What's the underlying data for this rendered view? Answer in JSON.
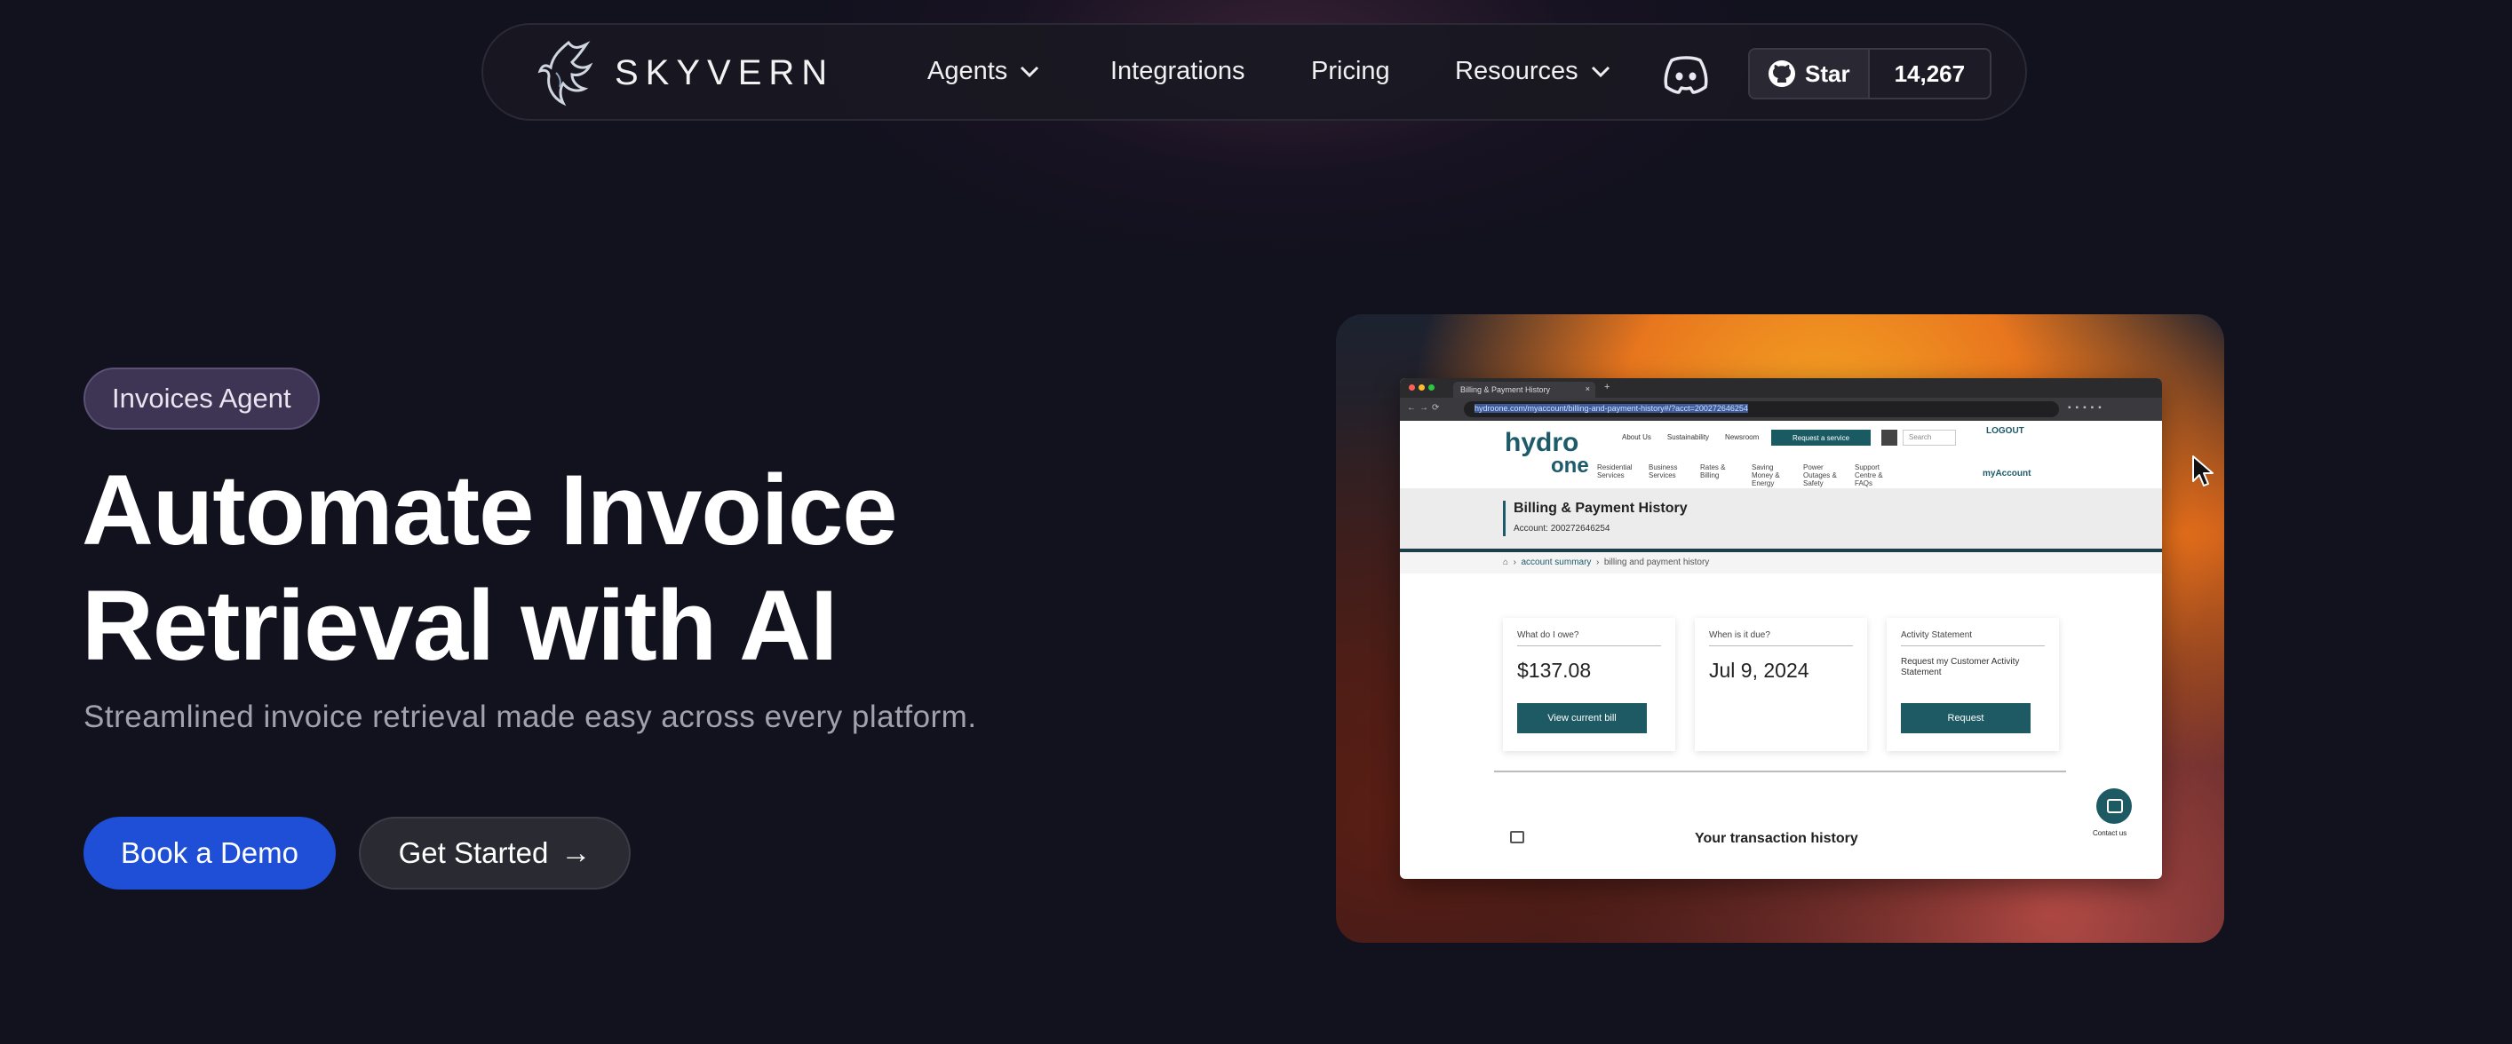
{
  "nav": {
    "brand": "SKYVERN",
    "items": [
      {
        "label": "Agents",
        "has_dropdown": true
      },
      {
        "label": "Integrations",
        "has_dropdown": false
      },
      {
        "label": "Pricing",
        "has_dropdown": false
      },
      {
        "label": "Resources",
        "has_dropdown": true
      }
    ],
    "discord_icon": "discord-icon",
    "github": {
      "star_label": "Star",
      "count": "14,267"
    }
  },
  "hero": {
    "badge": "Invoices Agent",
    "title_line1": "Automate Invoice",
    "title_line2": "Retrieval with AI",
    "subtitle": "Streamlined invoice retrieval made easy across every platform.",
    "primary_cta": "Book a Demo",
    "secondary_cta": "Get Started",
    "secondary_cta_arrow": "→"
  },
  "demo": {
    "tab_title": "Billing & Payment History",
    "url": "hydroone.com/myaccount/billing-and-payment-history#/?acct=200272646254",
    "site": {
      "brand_top": "hydro",
      "brand_bottom": "one",
      "top_links": [
        "About Us",
        "Sustainability",
        "Newsroom"
      ],
      "request_service": "Request a service",
      "search_placeholder": "Search",
      "logout": "LOGOUT",
      "my_account": "myAccount",
      "sub_links": [
        "Residential Services",
        "Business Services",
        "Rates & Billing",
        "Saving Money & Energy",
        "Power Outages & Safety",
        "Support Centre & FAQs"
      ]
    },
    "page_title": "Billing & Payment History",
    "account_label": "Account:",
    "account_number": "200272646254",
    "breadcrumb": [
      "account summary",
      "billing and payment history"
    ],
    "cards": [
      {
        "question": "What do I owe?",
        "value": "$137.08",
        "button": "View current bill"
      },
      {
        "question": "When is it due?",
        "value": "Jul 9, 2024"
      },
      {
        "question": "Activity Statement",
        "text": "Request my Customer Activity Statement",
        "button": "Request"
      }
    ],
    "transaction_history": "Your transaction history",
    "contact": "Contact us"
  },
  "colors": {
    "background": "#12111e",
    "primary_button": "#1f4fd6",
    "badge": "#3d3553",
    "hydro_teal": "#1d5a63"
  }
}
